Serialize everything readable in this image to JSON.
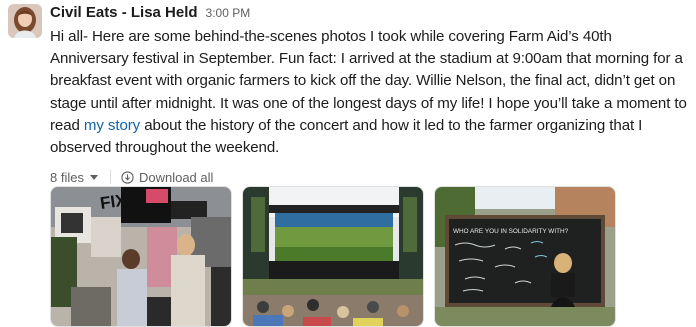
{
  "message": {
    "sender": "Civil Eats - Lisa Held",
    "time": "3:00 PM",
    "text_before": "Hi all- Here are some behind-the-scenes photos I took while covering Farm Aid’s 40th Anniversary festival in September. Fun fact: I arrived at the stadium at 9:00am that morning for a breakfast event with organic farmers to kick off the day. Willie Nelson, the final act, didn’t get on stage until after midnight. It was one of the longest days of my life! I hope you’ll take a moment to read ",
    "link_text": "my story",
    "text_after": " about the history of the concert and how it led to the farmer organizing that I observed throughout the weekend."
  },
  "files": {
    "count_label": "8 files",
    "download_label": "Download all"
  },
  "images": [
    {
      "sign_text": "FIX d"
    },
    {
      "scene": "stadium-stage"
    },
    {
      "board_text": "WHO ARE YOU IN SOLIDARITY WITH?"
    }
  ],
  "colors": {
    "link": "#1264a3",
    "text": "#1d1c1d",
    "muted": "#616061"
  }
}
